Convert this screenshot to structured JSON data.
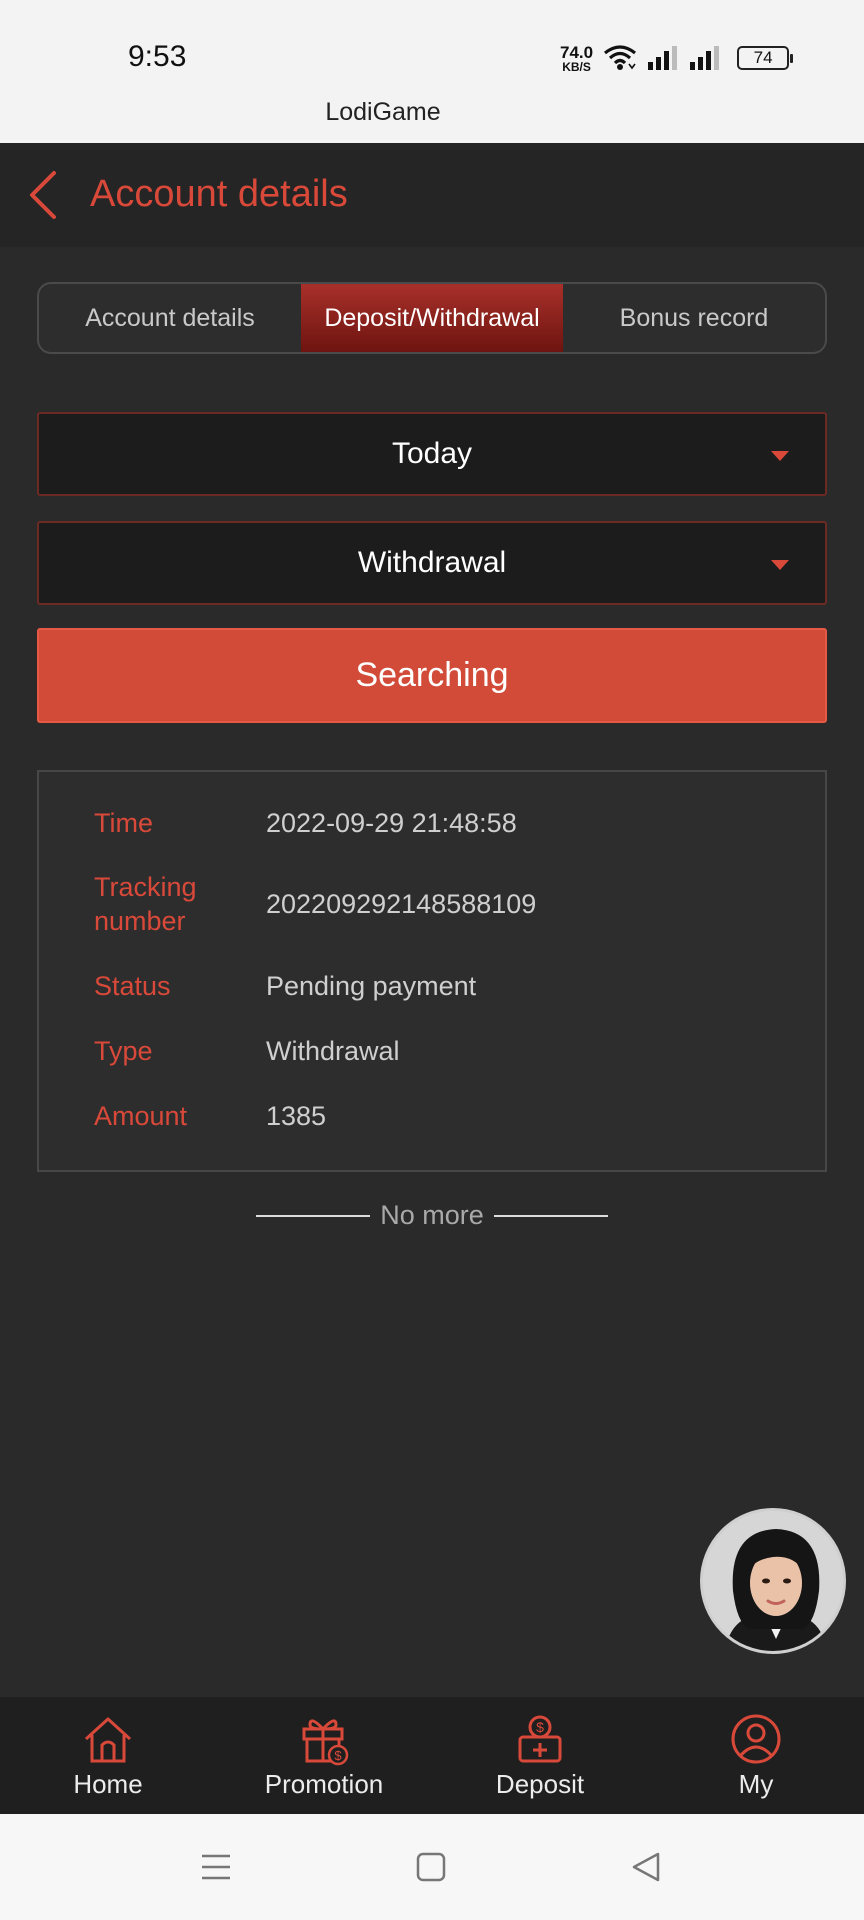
{
  "status_bar": {
    "time": "9:53",
    "net_speed_value": "74.0",
    "net_speed_unit": "KB/S",
    "battery": "74"
  },
  "app": {
    "title": "LodiGame"
  },
  "header": {
    "title": "Account details"
  },
  "tabs": [
    {
      "label": "Account details",
      "active": false
    },
    {
      "label": "Deposit/Withdrawal",
      "active": true
    },
    {
      "label": "Bonus record",
      "active": false
    }
  ],
  "filters": {
    "date": "Today",
    "type": "Withdrawal",
    "search_label": "Searching"
  },
  "record": {
    "time_label": "Time",
    "time_value": "2022-09-29 21:48:58",
    "tracking_label_1": "Tracking",
    "tracking_label_2": "number",
    "tracking_value": "202209292148588109",
    "status_label": "Status",
    "status_value": "Pending payment",
    "type_label": "Type",
    "type_value": "Withdrawal",
    "amount_label": "Amount",
    "amount_value": "1385"
  },
  "no_more": "No more",
  "nav": {
    "home": "Home",
    "promotion": "Promotion",
    "deposit": "Deposit",
    "my": "My"
  },
  "colors": {
    "accent": "#d9493a",
    "background": "#2a2a2a",
    "button": "#d24b38"
  }
}
